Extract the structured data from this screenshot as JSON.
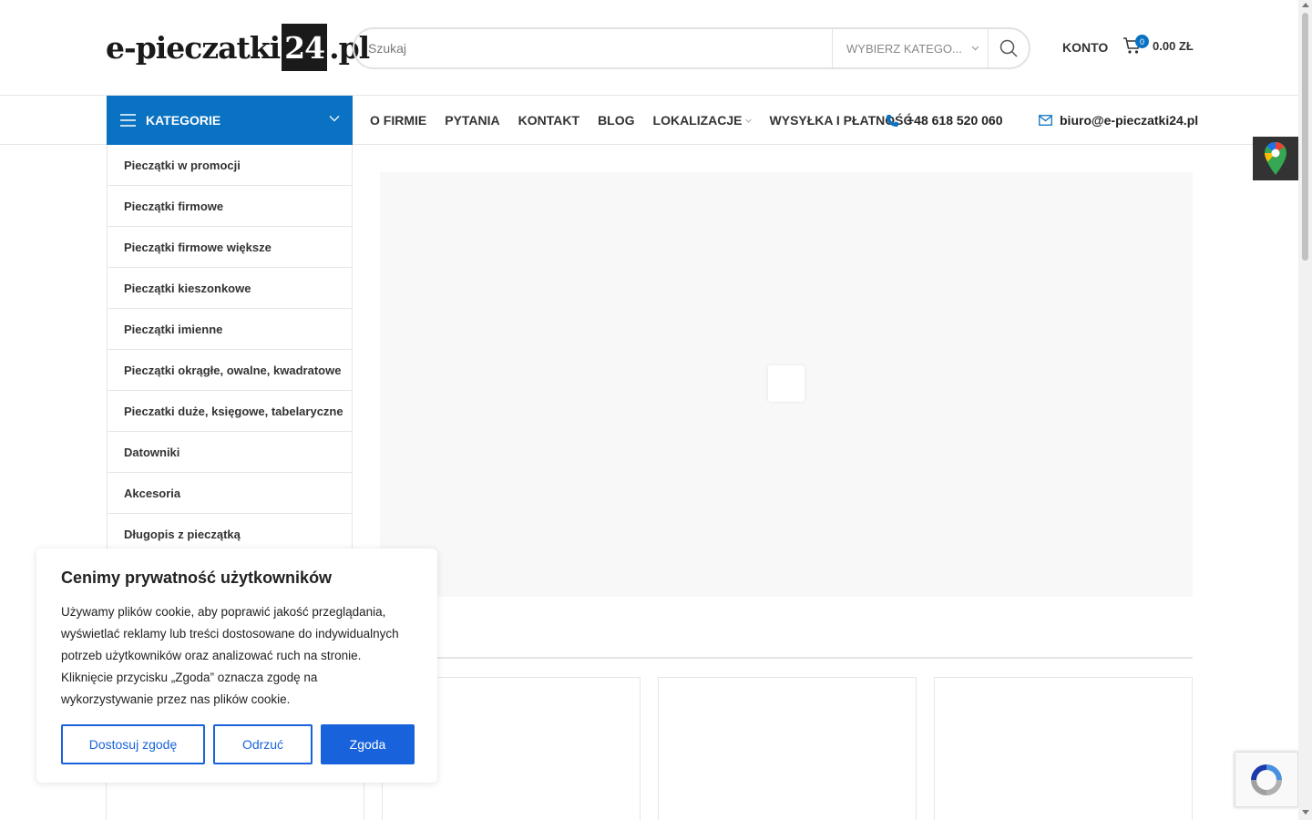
{
  "header": {
    "logo": {
      "part1": "e-pieczatki",
      "part2": "24",
      "part3": ".pl"
    },
    "search": {
      "placeholder": "Szukaj",
      "category_label": "Wybierz katego..."
    },
    "account_label": "KONTO",
    "cart": {
      "count": "0",
      "total": "0.00 ZŁ"
    }
  },
  "nav": {
    "categories_label": "Kategorie",
    "links": [
      "O firmie",
      "Pytania",
      "Kontakt",
      "Blog",
      "Lokalizacje",
      "Wysyłka i płatność"
    ],
    "phone": "+48 618 520 060",
    "email": "biuro@e-pieczatki24.pl"
  },
  "categories": [
    "Pieczątki w promocji",
    "Pieczątki firmowe",
    "Pieczątki firmowe większe",
    "Pieczątki kieszonkowe",
    "Pieczątki imienne",
    "Pieczątki okrągłe, owalne, kwadratowe",
    "Pieczatki duże, księgowe, tabelaryczne",
    "Datowniki",
    "Akcesoria",
    "Długopis z pieczątką"
  ],
  "cookie": {
    "title": "Cenimy prywatność użytkowników",
    "text": "Używamy plików cookie, aby poprawić jakość przeglądania, wyświetlać reklamy lub treści dostosowane do indywidualnych potrzeb użytkowników oraz analizować ruch na stronie. Kliknięcie przycisku „Zgoda” oznacza zgodę na wykorzystywanie przez nas plików cookie.",
    "customize_label": "Dostosuj zgodę",
    "reject_label": "Odrzuć",
    "accept_label": "Zgoda"
  },
  "colors": {
    "accent": "#0a72c2",
    "cookie_blue": "#1863dc"
  },
  "icons": [
    "menu-icon",
    "chevron-down-icon",
    "search-icon",
    "cart-icon",
    "phone-icon",
    "mail-icon",
    "google-maps-icon",
    "recaptcha-icon"
  ]
}
